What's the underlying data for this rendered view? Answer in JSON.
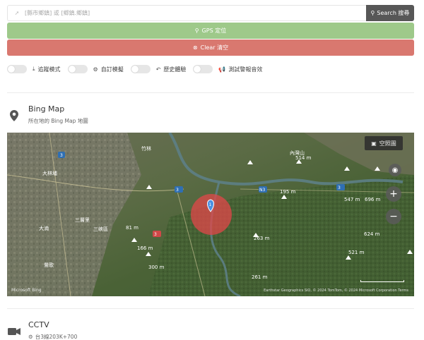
{
  "search": {
    "placeholder": "[縣市鄉鎮] 或 [鄉鎮.鄉鎮]",
    "button_label": "Search 搜尋"
  },
  "buttons": {
    "gps_label": "GPS 定位",
    "clear_label": "Clear 清空"
  },
  "toggles": [
    {
      "icon": "download-icon",
      "label": "追蹤模式",
      "on": false
    },
    {
      "icon": "cogs-icon",
      "label": "自訂模擬",
      "on": false
    },
    {
      "icon": "history-icon",
      "label": "歷史體驗",
      "on": false
    },
    {
      "icon": "bullhorn-icon",
      "label": "測試警報音效",
      "on": false
    }
  ],
  "bing_section": {
    "title": "Bing Map",
    "subtitle": "所在地的 Bing Map 地圖"
  },
  "map": {
    "style_button": "空照圖",
    "logo": "Microsoft Bing",
    "copyright": "Earthstar Geographics SIO, © 2024 TomTom, © 2024 Microsoft Corporation  Terms",
    "marker_label": "1",
    "labels": {
      "l1": "內灣山",
      "l2": "514 m",
      "l3": "195 m",
      "l4": "547 m",
      "l5": "696 m",
      "l6": "624 m",
      "l7": "521 m",
      "l8": "263 m",
      "l9": "261 m",
      "l10": "166 m",
      "l11": "300 m",
      "l12": "81 m",
      "l13": "大林埔",
      "l14": "三峽區",
      "l15": "竹林",
      "l16": "大湳",
      "l17": "三層里",
      "l18": "鶯歌"
    },
    "colors": {
      "circle": "#e2474a",
      "marker": "#4a90e2"
    }
  },
  "cctv_section": {
    "title": "CCTV",
    "subtitle": "台3線203K+700"
  },
  "colors": {
    "gps": "#9ec98a",
    "clear": "#d9786f",
    "search_btn": "#575757"
  }
}
